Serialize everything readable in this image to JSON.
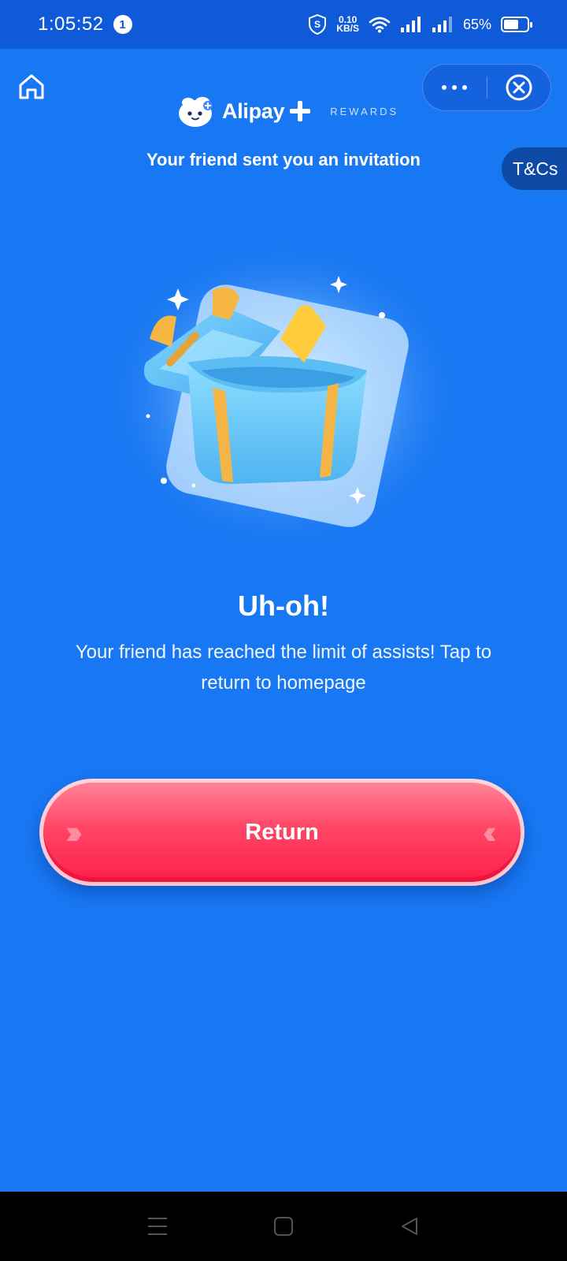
{
  "status_bar": {
    "time": "1:05:52",
    "notification_count": "1",
    "net_speed_value": "0.10",
    "net_speed_unit": "KB/S",
    "battery_percent": "65%",
    "battery_level": 0.65
  },
  "header": {
    "brand_name": "Alipay",
    "brand_suffix": "REWARDS",
    "invite_text": "Your friend sent you an invitation",
    "tcs_label": "T&Cs"
  },
  "content": {
    "title": "Uh-oh!",
    "message": "Your friend has reached the limit of assists! Tap to return to homepage",
    "return_label": "Return"
  },
  "icons": {
    "home": "home-icon",
    "more": "more-dots-icon",
    "close": "close-circle-icon",
    "gift": "open-gift-box-icon",
    "nav_menu": "menu-icon",
    "nav_home": "square-home-icon",
    "nav_back": "back-triangle-icon"
  },
  "colors": {
    "background": "#1877F2",
    "status_bar": "#0F5AD8",
    "return_button": "#FF3B5C",
    "tcs_tab": "#0C4AA6"
  }
}
